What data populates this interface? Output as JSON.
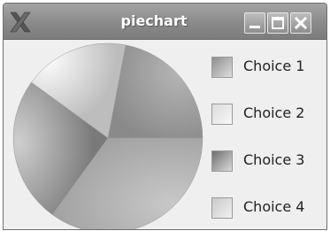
{
  "window": {
    "title": "piechart",
    "app_icon": "x-logo-icon",
    "buttons": [
      "minimize-icon",
      "maximize-icon",
      "close-icon"
    ]
  },
  "legend": {
    "items": [
      {
        "label": "Choice 1"
      },
      {
        "label": "Choice 2"
      },
      {
        "label": "Choice 3"
      },
      {
        "label": "Choice 4"
      }
    ]
  },
  "chart_data": {
    "type": "pie",
    "slices": [
      {
        "label": "Choice 1",
        "value": 22
      },
      {
        "label": "Choice 2",
        "value": 18
      },
      {
        "label": "Choice 3",
        "value": 25
      },
      {
        "label": "Choice 4",
        "value": 35
      }
    ]
  }
}
